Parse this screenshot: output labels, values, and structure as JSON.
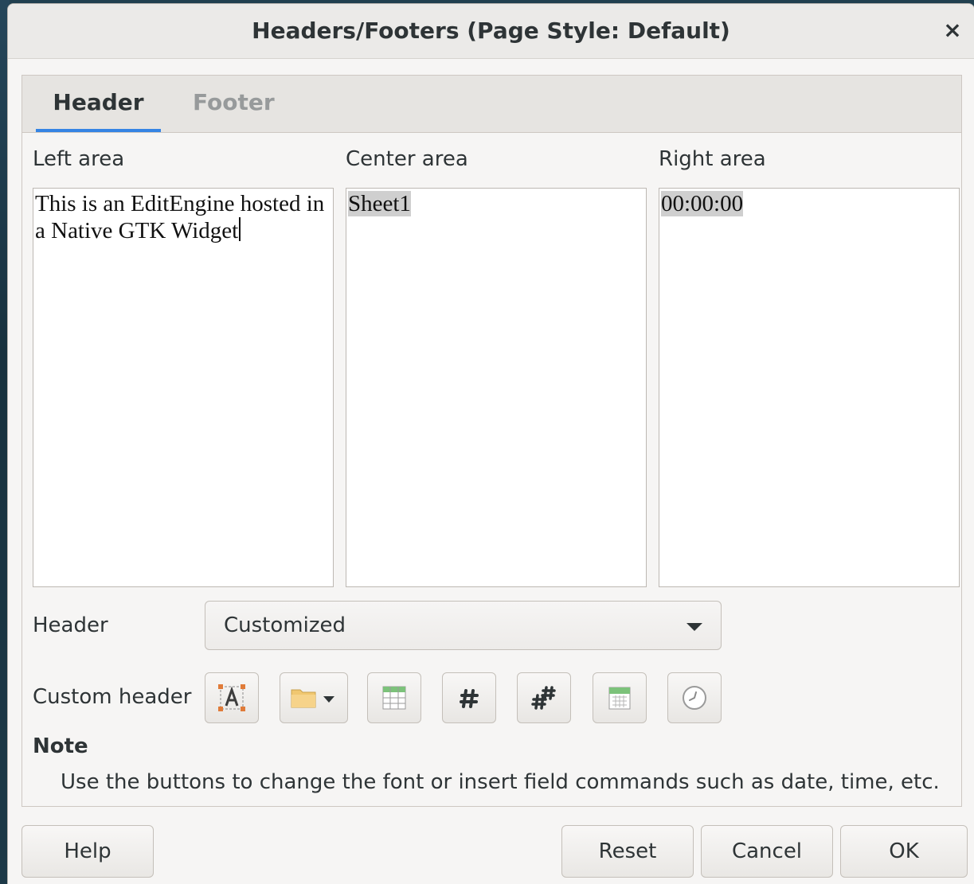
{
  "dialog": {
    "title": "Headers/Footers (Page Style: Default)",
    "close_glyph": "×"
  },
  "tabs": [
    {
      "label": "Header",
      "active": true
    },
    {
      "label": "Footer",
      "active": false
    }
  ],
  "areas": {
    "left": {
      "label": "Left area",
      "text": "This is an EditEngine hosted in a Native GTK Widget"
    },
    "center": {
      "label": "Center area",
      "text": "Sheet1"
    },
    "right": {
      "label": "Right area",
      "text": "00:00:00"
    }
  },
  "header_select": {
    "label": "Header",
    "value": "Customized"
  },
  "custom_header": {
    "label": "Custom header",
    "buttons": [
      {
        "icon": "text-attributes-icon"
      },
      {
        "icon": "folder-dropdown-icon"
      },
      {
        "icon": "sheet-name-icon"
      },
      {
        "icon": "page-number-icon"
      },
      {
        "icon": "page-count-icon"
      },
      {
        "icon": "date-icon"
      },
      {
        "icon": "time-icon"
      }
    ]
  },
  "note": {
    "title": "Note",
    "text": "Use the buttons to change the font or insert field commands such as date, time, etc."
  },
  "footer_buttons": {
    "help": "Help",
    "reset": "Reset",
    "cancel": "Cancel",
    "ok": "OK"
  },
  "colors": {
    "accent": "#3584e4",
    "selection_highlight": "#cfcfcf",
    "inactive_tab": "#979a9b"
  }
}
